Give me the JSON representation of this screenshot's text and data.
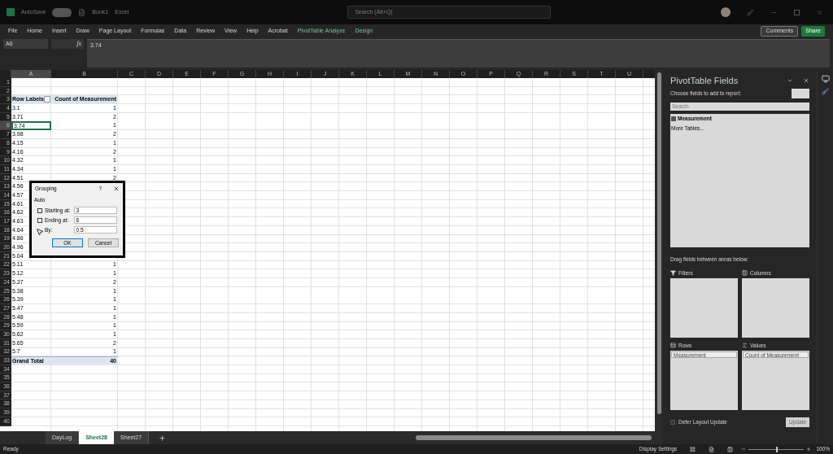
{
  "title_bar": {
    "autosave": "AutoSave",
    "autosave_on": false,
    "file": "Book1",
    "app": "Excel",
    "search_placeholder": "Search (Alt+Q)"
  },
  "ribbon_tabs": [
    {
      "label": "File",
      "contextual": false
    },
    {
      "label": "Home",
      "contextual": false
    },
    {
      "label": "Insert",
      "contextual": false
    },
    {
      "label": "Draw",
      "contextual": false
    },
    {
      "label": "Page Layout",
      "contextual": false
    },
    {
      "label": "Formulas",
      "contextual": false
    },
    {
      "label": "Data",
      "contextual": false
    },
    {
      "label": "Review",
      "contextual": false
    },
    {
      "label": "View",
      "contextual": false
    },
    {
      "label": "Help",
      "contextual": false
    },
    {
      "label": "Acrobat",
      "contextual": false
    },
    {
      "label": "PivotTable Analyze",
      "contextual": true
    },
    {
      "label": "Design",
      "contextual": true
    }
  ],
  "ribbon_buttons": {
    "comments": "Comments",
    "share": "Share"
  },
  "formula_bar": {
    "name_box": "A6",
    "fx": "fx",
    "value": "3.74"
  },
  "columns": [
    {
      "label": "A",
      "selected": true
    },
    {
      "label": "B",
      "selected": false
    },
    {
      "label": "C",
      "selected": false
    },
    {
      "label": "D",
      "selected": false
    },
    {
      "label": "E",
      "selected": false
    },
    {
      "label": "F",
      "selected": false
    },
    {
      "label": "G",
      "selected": false
    },
    {
      "label": "H",
      "selected": false
    },
    {
      "label": "I",
      "selected": false
    },
    {
      "label": "J",
      "selected": false
    },
    {
      "label": "K",
      "selected": false
    },
    {
      "label": "L",
      "selected": false
    },
    {
      "label": "M",
      "selected": false
    },
    {
      "label": "N",
      "selected": false
    },
    {
      "label": "O",
      "selected": false
    },
    {
      "label": "P",
      "selected": false
    },
    {
      "label": "Q",
      "selected": false
    },
    {
      "label": "R",
      "selected": false
    },
    {
      "label": "S",
      "selected": false
    },
    {
      "label": "T",
      "selected": false
    },
    {
      "label": "U",
      "selected": false
    }
  ],
  "rows": [
    {
      "num": "1",
      "kind": "empty",
      "selected": false
    },
    {
      "num": "2",
      "kind": "empty",
      "selected": false
    },
    {
      "num": "3",
      "kind": "header",
      "selected": false,
      "a": "Row Labels",
      "b": "Count of Measurement"
    },
    {
      "num": "4",
      "kind": "item",
      "selected": false,
      "a": "3.1",
      "b": "1"
    },
    {
      "num": "5",
      "kind": "item",
      "selected": false,
      "a": "3.71",
      "b": "2"
    },
    {
      "num": "6",
      "kind": "item",
      "selected": true,
      "a": "3.74",
      "b": "1"
    },
    {
      "num": "7",
      "kind": "item",
      "selected": false,
      "a": "3.98",
      "b": "2"
    },
    {
      "num": "8",
      "kind": "item",
      "selected": false,
      "a": "4.15",
      "b": "1"
    },
    {
      "num": "9",
      "kind": "item",
      "selected": false,
      "a": "4.16",
      "b": "2"
    },
    {
      "num": "10",
      "kind": "item",
      "selected": false,
      "a": "4.32",
      "b": "1"
    },
    {
      "num": "11",
      "kind": "item",
      "selected": false,
      "a": "4.34",
      "b": "1"
    },
    {
      "num": "12",
      "kind": "item",
      "selected": false,
      "a": "4.51",
      "b": "2"
    },
    {
      "num": "13",
      "kind": "item",
      "selected": false,
      "a": "4.56"
    },
    {
      "num": "14",
      "kind": "item",
      "selected": false,
      "a": "4.57"
    },
    {
      "num": "15",
      "kind": "item",
      "selected": false,
      "a": "4.61"
    },
    {
      "num": "16",
      "kind": "item",
      "selected": false,
      "a": "4.62"
    },
    {
      "num": "17",
      "kind": "item",
      "selected": false,
      "a": "4.63"
    },
    {
      "num": "18",
      "kind": "item",
      "selected": false,
      "a": "4.64"
    },
    {
      "num": "19",
      "kind": "item",
      "selected": false,
      "a": "4.86"
    },
    {
      "num": "20",
      "kind": "item",
      "selected": false,
      "a": "4.96"
    },
    {
      "num": "21",
      "kind": "item",
      "selected": false,
      "a": "5.04"
    },
    {
      "num": "22",
      "kind": "item",
      "selected": false,
      "a": "5.11",
      "b": "1"
    },
    {
      "num": "23",
      "kind": "item",
      "selected": false,
      "a": "5.12",
      "b": "1"
    },
    {
      "num": "24",
      "kind": "item",
      "selected": false,
      "a": "5.37",
      "b": "2"
    },
    {
      "num": "25",
      "kind": "item",
      "selected": false,
      "a": "5.38",
      "b": "1"
    },
    {
      "num": "26",
      "kind": "item",
      "selected": false,
      "a": "5.39",
      "b": "1"
    },
    {
      "num": "27",
      "kind": "item",
      "selected": false,
      "a": "5.47",
      "b": "1"
    },
    {
      "num": "28",
      "kind": "item",
      "selected": false,
      "a": "5.48",
      "b": "1"
    },
    {
      "num": "29",
      "kind": "item",
      "selected": false,
      "a": "5.59",
      "b": "1"
    },
    {
      "num": "30",
      "kind": "item",
      "selected": false,
      "a": "5.62",
      "b": "1"
    },
    {
      "num": "31",
      "kind": "item",
      "selected": false,
      "a": "5.65",
      "b": "2"
    },
    {
      "num": "32",
      "kind": "item",
      "selected": false,
      "a": "5.7",
      "b": "1"
    },
    {
      "num": "33",
      "kind": "total",
      "selected": false,
      "a": "Grand Total",
      "b": "40"
    },
    {
      "num": "34",
      "kind": "empty",
      "selected": false
    },
    {
      "num": "35",
      "kind": "empty",
      "selected": false
    },
    {
      "num": "36",
      "kind": "empty",
      "selected": false
    },
    {
      "num": "37",
      "kind": "empty",
      "selected": false
    },
    {
      "num": "38",
      "kind": "empty",
      "selected": false
    },
    {
      "num": "39",
      "kind": "empty",
      "selected": false
    },
    {
      "num": "40",
      "kind": "empty",
      "selected": false
    }
  ],
  "dialog": {
    "title": "Grouping",
    "help": "?",
    "section": "Auto",
    "fields": [
      {
        "label": "Starting at:",
        "value": "3",
        "kind": "check",
        "checked": false
      },
      {
        "label": "Ending at:",
        "value": "6",
        "kind": "check",
        "checked": false
      },
      {
        "label": "By:",
        "value": "0.5",
        "kind": "plain"
      }
    ],
    "ok": "OK",
    "cancel": "Cancel"
  },
  "sheet_tabs": [
    {
      "label": "DayLog",
      "selected": false
    },
    {
      "label": "Sheet28",
      "selected": true
    },
    {
      "label": "Sheet27",
      "selected": false
    }
  ],
  "pivot_panel": {
    "title": "PivotTable Fields",
    "choose": "Choose fields to add to report:",
    "search_placeholder": "Search",
    "fields": [
      {
        "label": "Measurement",
        "checked": true
      }
    ],
    "more_tables": "More Tables...",
    "drag_hint": "Drag fields between areas below:",
    "areas": [
      {
        "label": "Filters",
        "kind": "filters"
      },
      {
        "label": "Columns",
        "kind": "columns"
      },
      {
        "label": "Rows",
        "kind": "rows",
        "items": [
          "Measurement"
        ]
      },
      {
        "label": "Values",
        "kind": "values",
        "items": [
          "Count of Measurement"
        ]
      }
    ],
    "defer": {
      "label": "Defer Layout Update",
      "checked": false
    },
    "update": {
      "label": "Update",
      "disabled": true
    }
  },
  "status_bar": {
    "status": "Ready",
    "display_settings": "Display Settings",
    "zoom": "100%",
    "zoom_slider": {
      "level": 0.5
    }
  }
}
